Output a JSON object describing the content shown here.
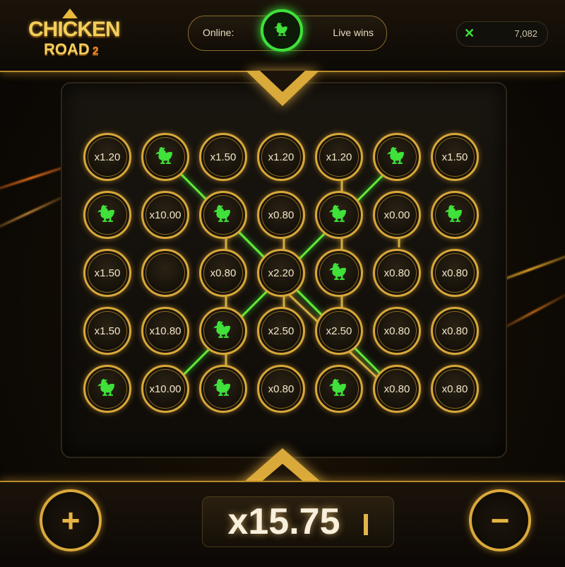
{
  "logo": {
    "line1": "CHICKEN",
    "line2": "ROAD",
    "version": "2"
  },
  "header": {
    "online_label": "Online:",
    "live_wins_label": "Live wins"
  },
  "balance": {
    "icon": "x-icon",
    "value": "7,082"
  },
  "grid": {
    "rows": [
      [
        {
          "t": "x1.20"
        },
        {
          "chicken": true
        },
        {
          "t": "x1.50"
        },
        {
          "t": "x1.20"
        },
        {
          "t": "x1.20"
        },
        {
          "chicken": true
        },
        {
          "t": "x1.50"
        }
      ],
      [
        {
          "chicken": true
        },
        {
          "t": "x10.00"
        },
        {
          "chicken": true
        },
        {
          "t": "x0.80"
        },
        {
          "chicken": true
        },
        {
          "t": "x0.00"
        },
        {
          "chicken": true
        }
      ],
      [
        {
          "t": "x1.50"
        },
        {
          "t": ""
        },
        {
          "t": "x0.80"
        },
        {
          "t": "x2.20"
        },
        {
          "chicken": true
        },
        {
          "t": "x0.80"
        },
        {
          "t": "x0.80"
        }
      ],
      [
        {
          "t": "x1.50"
        },
        {
          "t": "x10.80"
        },
        {
          "chicken": true
        },
        {
          "t": "x2.50"
        },
        {
          "t": "x2.50"
        },
        {
          "t": "x0.80"
        },
        {
          "t": "x0.80"
        }
      ],
      [
        {
          "chicken": true
        },
        {
          "t": "x10.00"
        },
        {
          "chicken": true
        },
        {
          "t": "x0.80"
        },
        {
          "chicken": true
        },
        {
          "t": "x0.80"
        },
        {
          "t": "x0.80"
        }
      ]
    ]
  },
  "controls": {
    "plus_label": "+",
    "minus_label": "−",
    "multiplier": "x15.75"
  },
  "colors": {
    "accent_gold": "#d9a93a",
    "chicken_green": "#3fe13a"
  }
}
